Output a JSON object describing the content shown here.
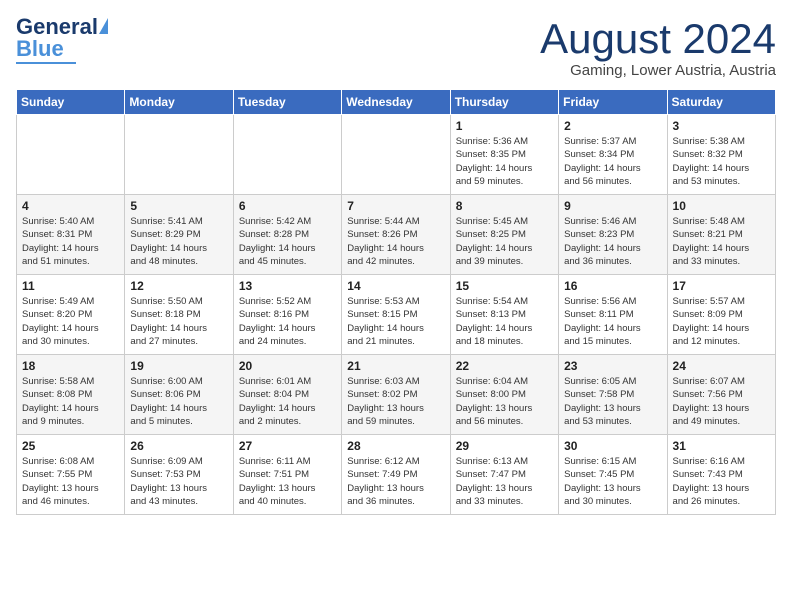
{
  "header": {
    "logo_text_general": "General",
    "logo_text_blue": "Blue",
    "month_year": "August 2024",
    "location": "Gaming, Lower Austria, Austria"
  },
  "days_of_week": [
    "Sunday",
    "Monday",
    "Tuesday",
    "Wednesday",
    "Thursday",
    "Friday",
    "Saturday"
  ],
  "weeks": [
    [
      {
        "day": "",
        "info": ""
      },
      {
        "day": "",
        "info": ""
      },
      {
        "day": "",
        "info": ""
      },
      {
        "day": "",
        "info": ""
      },
      {
        "day": "1",
        "info": "Sunrise: 5:36 AM\nSunset: 8:35 PM\nDaylight: 14 hours\nand 59 minutes."
      },
      {
        "day": "2",
        "info": "Sunrise: 5:37 AM\nSunset: 8:34 PM\nDaylight: 14 hours\nand 56 minutes."
      },
      {
        "day": "3",
        "info": "Sunrise: 5:38 AM\nSunset: 8:32 PM\nDaylight: 14 hours\nand 53 minutes."
      }
    ],
    [
      {
        "day": "4",
        "info": "Sunrise: 5:40 AM\nSunset: 8:31 PM\nDaylight: 14 hours\nand 51 minutes."
      },
      {
        "day": "5",
        "info": "Sunrise: 5:41 AM\nSunset: 8:29 PM\nDaylight: 14 hours\nand 48 minutes."
      },
      {
        "day": "6",
        "info": "Sunrise: 5:42 AM\nSunset: 8:28 PM\nDaylight: 14 hours\nand 45 minutes."
      },
      {
        "day": "7",
        "info": "Sunrise: 5:44 AM\nSunset: 8:26 PM\nDaylight: 14 hours\nand 42 minutes."
      },
      {
        "day": "8",
        "info": "Sunrise: 5:45 AM\nSunset: 8:25 PM\nDaylight: 14 hours\nand 39 minutes."
      },
      {
        "day": "9",
        "info": "Sunrise: 5:46 AM\nSunset: 8:23 PM\nDaylight: 14 hours\nand 36 minutes."
      },
      {
        "day": "10",
        "info": "Sunrise: 5:48 AM\nSunset: 8:21 PM\nDaylight: 14 hours\nand 33 minutes."
      }
    ],
    [
      {
        "day": "11",
        "info": "Sunrise: 5:49 AM\nSunset: 8:20 PM\nDaylight: 14 hours\nand 30 minutes."
      },
      {
        "day": "12",
        "info": "Sunrise: 5:50 AM\nSunset: 8:18 PM\nDaylight: 14 hours\nand 27 minutes."
      },
      {
        "day": "13",
        "info": "Sunrise: 5:52 AM\nSunset: 8:16 PM\nDaylight: 14 hours\nand 24 minutes."
      },
      {
        "day": "14",
        "info": "Sunrise: 5:53 AM\nSunset: 8:15 PM\nDaylight: 14 hours\nand 21 minutes."
      },
      {
        "day": "15",
        "info": "Sunrise: 5:54 AM\nSunset: 8:13 PM\nDaylight: 14 hours\nand 18 minutes."
      },
      {
        "day": "16",
        "info": "Sunrise: 5:56 AM\nSunset: 8:11 PM\nDaylight: 14 hours\nand 15 minutes."
      },
      {
        "day": "17",
        "info": "Sunrise: 5:57 AM\nSunset: 8:09 PM\nDaylight: 14 hours\nand 12 minutes."
      }
    ],
    [
      {
        "day": "18",
        "info": "Sunrise: 5:58 AM\nSunset: 8:08 PM\nDaylight: 14 hours\nand 9 minutes."
      },
      {
        "day": "19",
        "info": "Sunrise: 6:00 AM\nSunset: 8:06 PM\nDaylight: 14 hours\nand 5 minutes."
      },
      {
        "day": "20",
        "info": "Sunrise: 6:01 AM\nSunset: 8:04 PM\nDaylight: 14 hours\nand 2 minutes."
      },
      {
        "day": "21",
        "info": "Sunrise: 6:03 AM\nSunset: 8:02 PM\nDaylight: 13 hours\nand 59 minutes."
      },
      {
        "day": "22",
        "info": "Sunrise: 6:04 AM\nSunset: 8:00 PM\nDaylight: 13 hours\nand 56 minutes."
      },
      {
        "day": "23",
        "info": "Sunrise: 6:05 AM\nSunset: 7:58 PM\nDaylight: 13 hours\nand 53 minutes."
      },
      {
        "day": "24",
        "info": "Sunrise: 6:07 AM\nSunset: 7:56 PM\nDaylight: 13 hours\nand 49 minutes."
      }
    ],
    [
      {
        "day": "25",
        "info": "Sunrise: 6:08 AM\nSunset: 7:55 PM\nDaylight: 13 hours\nand 46 minutes."
      },
      {
        "day": "26",
        "info": "Sunrise: 6:09 AM\nSunset: 7:53 PM\nDaylight: 13 hours\nand 43 minutes."
      },
      {
        "day": "27",
        "info": "Sunrise: 6:11 AM\nSunset: 7:51 PM\nDaylight: 13 hours\nand 40 minutes."
      },
      {
        "day": "28",
        "info": "Sunrise: 6:12 AM\nSunset: 7:49 PM\nDaylight: 13 hours\nand 36 minutes."
      },
      {
        "day": "29",
        "info": "Sunrise: 6:13 AM\nSunset: 7:47 PM\nDaylight: 13 hours\nand 33 minutes."
      },
      {
        "day": "30",
        "info": "Sunrise: 6:15 AM\nSunset: 7:45 PM\nDaylight: 13 hours\nand 30 minutes."
      },
      {
        "day": "31",
        "info": "Sunrise: 6:16 AM\nSunset: 7:43 PM\nDaylight: 13 hours\nand 26 minutes."
      }
    ]
  ]
}
